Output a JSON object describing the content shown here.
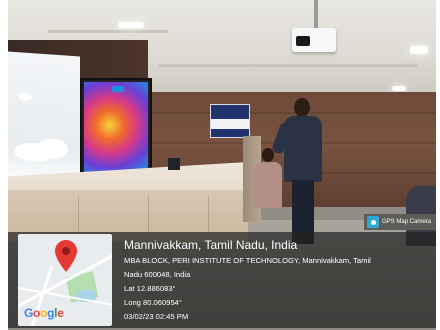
{
  "gps_tag": {
    "label": "GPS Map Camera",
    "icon": "camera-pin-icon"
  },
  "gps_overlay": {
    "title": "Mannivakkam, Tamil Nadu, India",
    "address_line1": "MBA BLOCK, PERI INSTITUTE OF TECHNOLOGY, Mannivakkam, Tamil",
    "address_line2": "Nadu 600048, India",
    "latitude": "Lat 12.886083°",
    "longitude": "Long 80.060954°",
    "datetime": "03/02/23 02:45 PM"
  },
  "map": {
    "brand": "Google",
    "pin_color": "#e53935",
    "brand_colors": [
      "#4285F4",
      "#EA4335",
      "#FBBC05",
      "#4285F4",
      "#34A853",
      "#EA4335"
    ]
  }
}
